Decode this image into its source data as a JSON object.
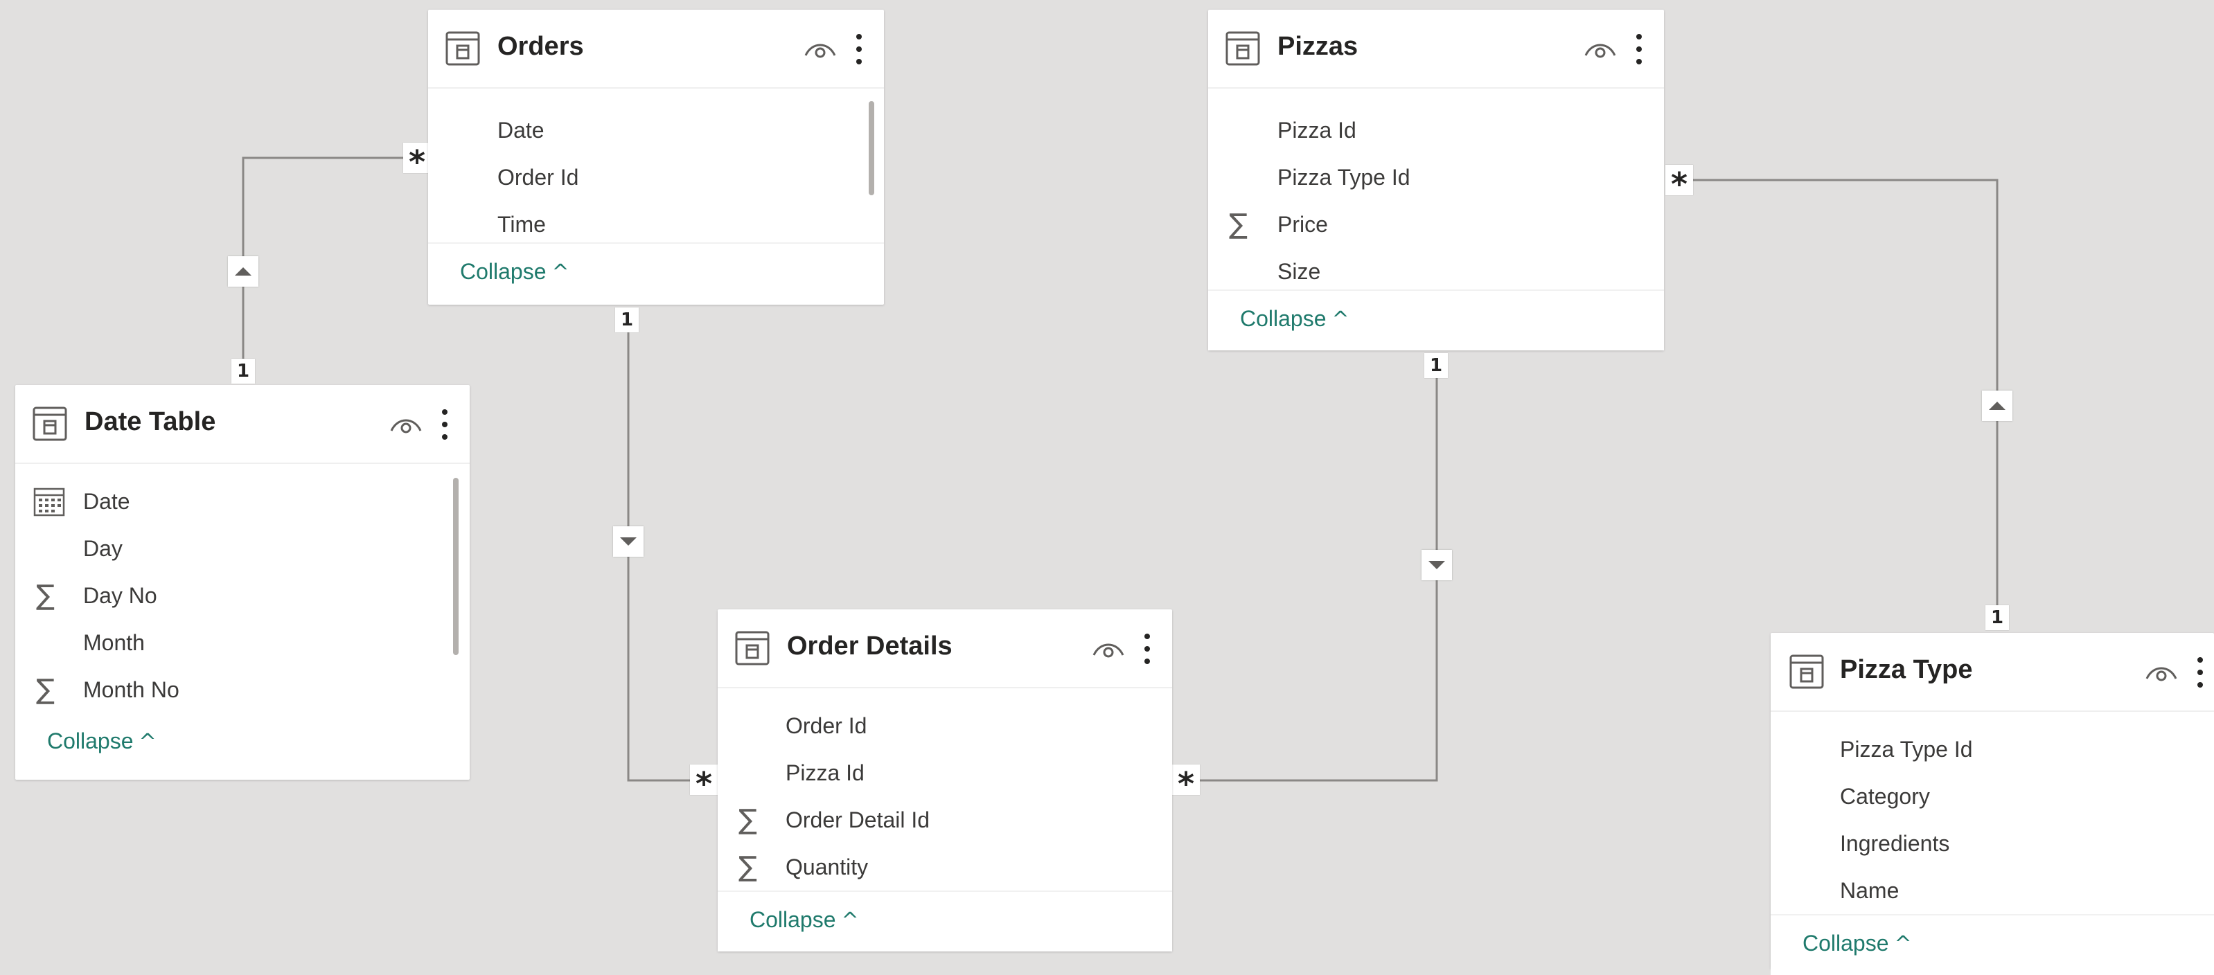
{
  "colors": {
    "canvas": "#e1e0df",
    "card": "#ffffff",
    "title": "#252423",
    "field_text": "#3b3a39",
    "collapse_link": "#1f7a6c",
    "relationship_line": "#8a8886"
  },
  "tables": {
    "orders": {
      "title": "Orders",
      "fields": [
        {
          "label": "Date",
          "icon": ""
        },
        {
          "label": "Order Id",
          "icon": ""
        },
        {
          "label": "Time",
          "icon": ""
        }
      ],
      "collapse_label": "Collapse"
    },
    "pizzas": {
      "title": "Pizzas",
      "fields": [
        {
          "label": "Pizza Id",
          "icon": ""
        },
        {
          "label": "Pizza Type Id",
          "icon": ""
        },
        {
          "label": "Price",
          "icon": "sigma-icon"
        },
        {
          "label": "Size",
          "icon": ""
        }
      ],
      "collapse_label": "Collapse"
    },
    "date_table": {
      "title": "Date Table",
      "fields": [
        {
          "label": "Date",
          "icon": "calendar-icon"
        },
        {
          "label": "Day",
          "icon": ""
        },
        {
          "label": "Day No",
          "icon": "sigma-icon"
        },
        {
          "label": "Month",
          "icon": ""
        },
        {
          "label": "Month No",
          "icon": "sigma-icon"
        }
      ],
      "collapse_label": "Collapse"
    },
    "order_details": {
      "title": "Order Details",
      "fields": [
        {
          "label": "Order Id",
          "icon": ""
        },
        {
          "label": "Pizza Id",
          "icon": ""
        },
        {
          "label": "Order Detail Id",
          "icon": "sigma-icon"
        },
        {
          "label": "Quantity",
          "icon": "sigma-icon"
        }
      ],
      "collapse_label": "Collapse"
    },
    "pizza_type": {
      "title": "Pizza Type",
      "fields": [
        {
          "label": "Pizza Type Id",
          "icon": ""
        },
        {
          "label": "Category",
          "icon": ""
        },
        {
          "label": "Ingredients",
          "icon": ""
        },
        {
          "label": "Name",
          "icon": ""
        }
      ],
      "collapse_label": "Collapse"
    }
  },
  "relationships": [
    {
      "from": "Date Table",
      "to": "Orders",
      "from_cardinality": "1",
      "to_cardinality": "*",
      "filter_direction": "up"
    },
    {
      "from": "Orders",
      "to": "Order Details",
      "from_cardinality": "1",
      "to_cardinality": "*",
      "filter_direction": "down"
    },
    {
      "from": "Pizzas",
      "to": "Order Details",
      "from_cardinality": "1",
      "to_cardinality": "*",
      "filter_direction": "down"
    },
    {
      "from": "Pizza Type",
      "to": "Pizzas",
      "from_cardinality": "1",
      "to_cardinality": "*",
      "filter_direction": "up"
    }
  ],
  "icons": {
    "table": "table-icon",
    "visibility": "eye-icon",
    "more": "more-options-icon",
    "collapse_chevron": "^"
  }
}
